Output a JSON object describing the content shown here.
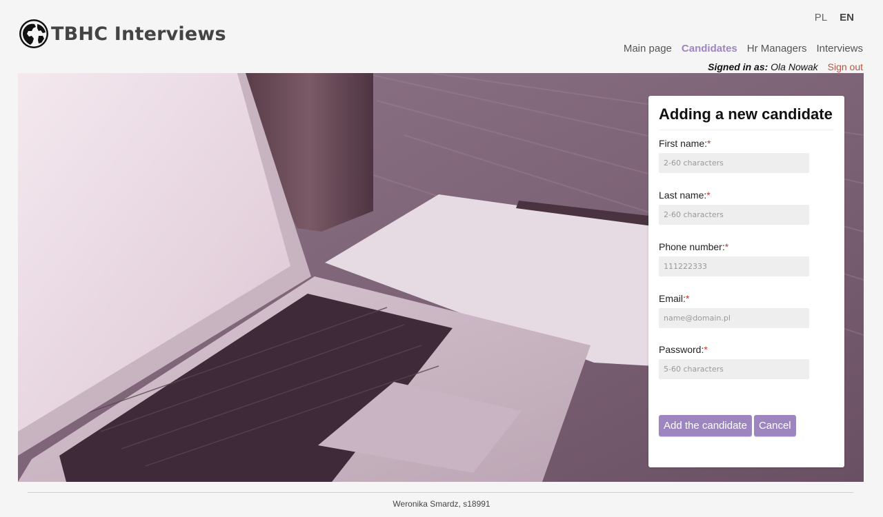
{
  "brand": {
    "title": "TBHC Interviews",
    "icon": "globe-icon"
  },
  "languages": {
    "pl": "PL",
    "en": "EN",
    "active": "EN"
  },
  "nav": {
    "items": [
      {
        "label": "Main page"
      },
      {
        "label": "Candidates"
      },
      {
        "label": "Hr Managers"
      },
      {
        "label": "Interviews"
      }
    ],
    "active": "Candidates"
  },
  "session": {
    "signed_label": "Signed in as:",
    "user": "Ola Nowak",
    "signout": "Sign out"
  },
  "hero": {
    "image": "laptop-on-desk-photo"
  },
  "form": {
    "title": "Adding a new candidate",
    "fields": [
      {
        "label": "First name:",
        "required": "*",
        "placeholder": "2-60 characters",
        "value": ""
      },
      {
        "label": "Last name:",
        "required": "*",
        "placeholder": "2-60 characters",
        "value": ""
      },
      {
        "label": "Phone number:",
        "required": "*",
        "placeholder": "111222333",
        "value": ""
      },
      {
        "label": "Email:",
        "required": "*",
        "placeholder": "name@domain.pl",
        "value": ""
      },
      {
        "label": "Password:",
        "required": "*",
        "placeholder": "5-60 characters",
        "value": ""
      }
    ],
    "submit": "Add the candidate",
    "cancel": "Cancel"
  },
  "footer": {
    "text": "Weronika Smardz, s18991"
  },
  "colors": {
    "accent": "#9d86c0",
    "signout": "#c0523a",
    "required": "#c0392b"
  }
}
